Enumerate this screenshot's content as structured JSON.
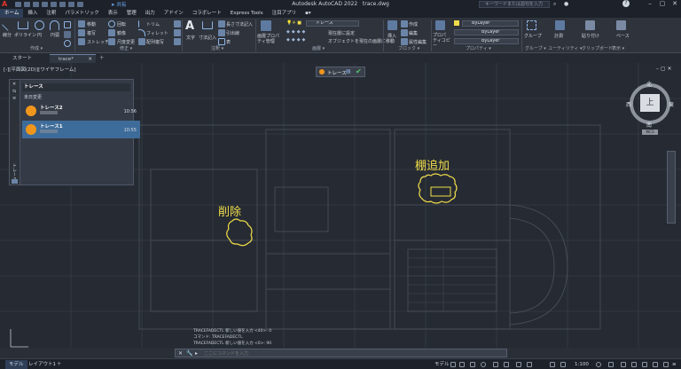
{
  "app": {
    "title": "Autodesk AutoCAD 2022",
    "filename": "trace.dwg",
    "share_label": "共有",
    "search_placeholder": "キーワードまたは語句を入力"
  },
  "menu": [
    "ホーム",
    "挿入",
    "注釈",
    "パラメトリック",
    "表示",
    "管理",
    "出力",
    "アドイン",
    "コラボレート",
    "Express Tools",
    "注目アプリ"
  ],
  "ribbon": {
    "draw": {
      "line": "線分",
      "polyline": "ポリライン",
      "circle": "円",
      "arc": "円弧",
      "group": "作成 ▾"
    },
    "modify": {
      "move": "移動",
      "rotate": "回転",
      "trim": "トリム",
      "copy": "複写",
      "mirror": "鏡像",
      "fillet": "フィレット",
      "stretch": "ストレッチ",
      "scale": "尺度変更",
      "array": "配列複写",
      "group": "修正 ▾"
    },
    "annotation": {
      "text": "文字",
      "dimension": "寸法記入",
      "leader": "引出線",
      "table": "表",
      "linear": "長さ寸法記入",
      "group": "注釈 ▾"
    },
    "layers": {
      "layer_properties": "画層プロパティ管理",
      "current_layer": "トレース",
      "make_current": "現在層に設定",
      "match_layer": "オブジェクトを現在の画層に移動",
      "group": "画層 ▾"
    },
    "block": {
      "insert": "挿入",
      "create": "作成",
      "edit": "編集",
      "edit_attributes": "属性編集",
      "group": "ブロック ▾"
    },
    "properties": {
      "match": "プロパティコピー",
      "color": "ByLayer",
      "linetype": "ByLayer",
      "lineweight": "ByLayer",
      "group": "プロパティ ▾"
    },
    "groups": {
      "group": "グループ",
      "label": "グループ ▾"
    },
    "utilities": {
      "measure": "計測",
      "label": "ユーティリティ ▾"
    },
    "clipboard": {
      "paste": "貼り付け",
      "label": "クリップボード"
    },
    "view": {
      "base": "ベース",
      "label": "表示 ▾"
    }
  },
  "tabs": [
    {
      "label": "スタート"
    },
    {
      "label": "trace*"
    }
  ],
  "viewport_label": "[-][平面図(2D)][ワイヤフレーム]",
  "trace_palette": {
    "title": "トレース",
    "section": "未日変更",
    "side_label": "トレース",
    "items": [
      {
        "name": "トレース2",
        "time": "10:56",
        "selected": false
      },
      {
        "name": "トレース1",
        "time": "10:55",
        "selected": true
      }
    ]
  },
  "trace_toolbar": {
    "label": "トレース"
  },
  "annotations": [
    {
      "text": "削除"
    },
    {
      "text": "棚追加"
    }
  ],
  "viewcube": {
    "north": "北",
    "south": "南",
    "west": "西",
    "east": "東",
    "top": "上",
    "wcs": "WCS"
  },
  "command": {
    "history": [
      "TRACEFADECTL 新しい値を入力 <40>: 0",
      "コマンド: TRACEFADECTL",
      "TRACEFADECTL 新しい値を入力 <0>: 90"
    ],
    "placeholder": "ここにコマンドを入力"
  },
  "status": {
    "model_tab": "モデル",
    "layout_tab": "レイアウト1",
    "model_label": "モデル",
    "scale": "1:100"
  },
  "colors": {
    "annotation": "#f0dc4a",
    "trace_dot": "#f0961c",
    "background": "#262b33"
  }
}
